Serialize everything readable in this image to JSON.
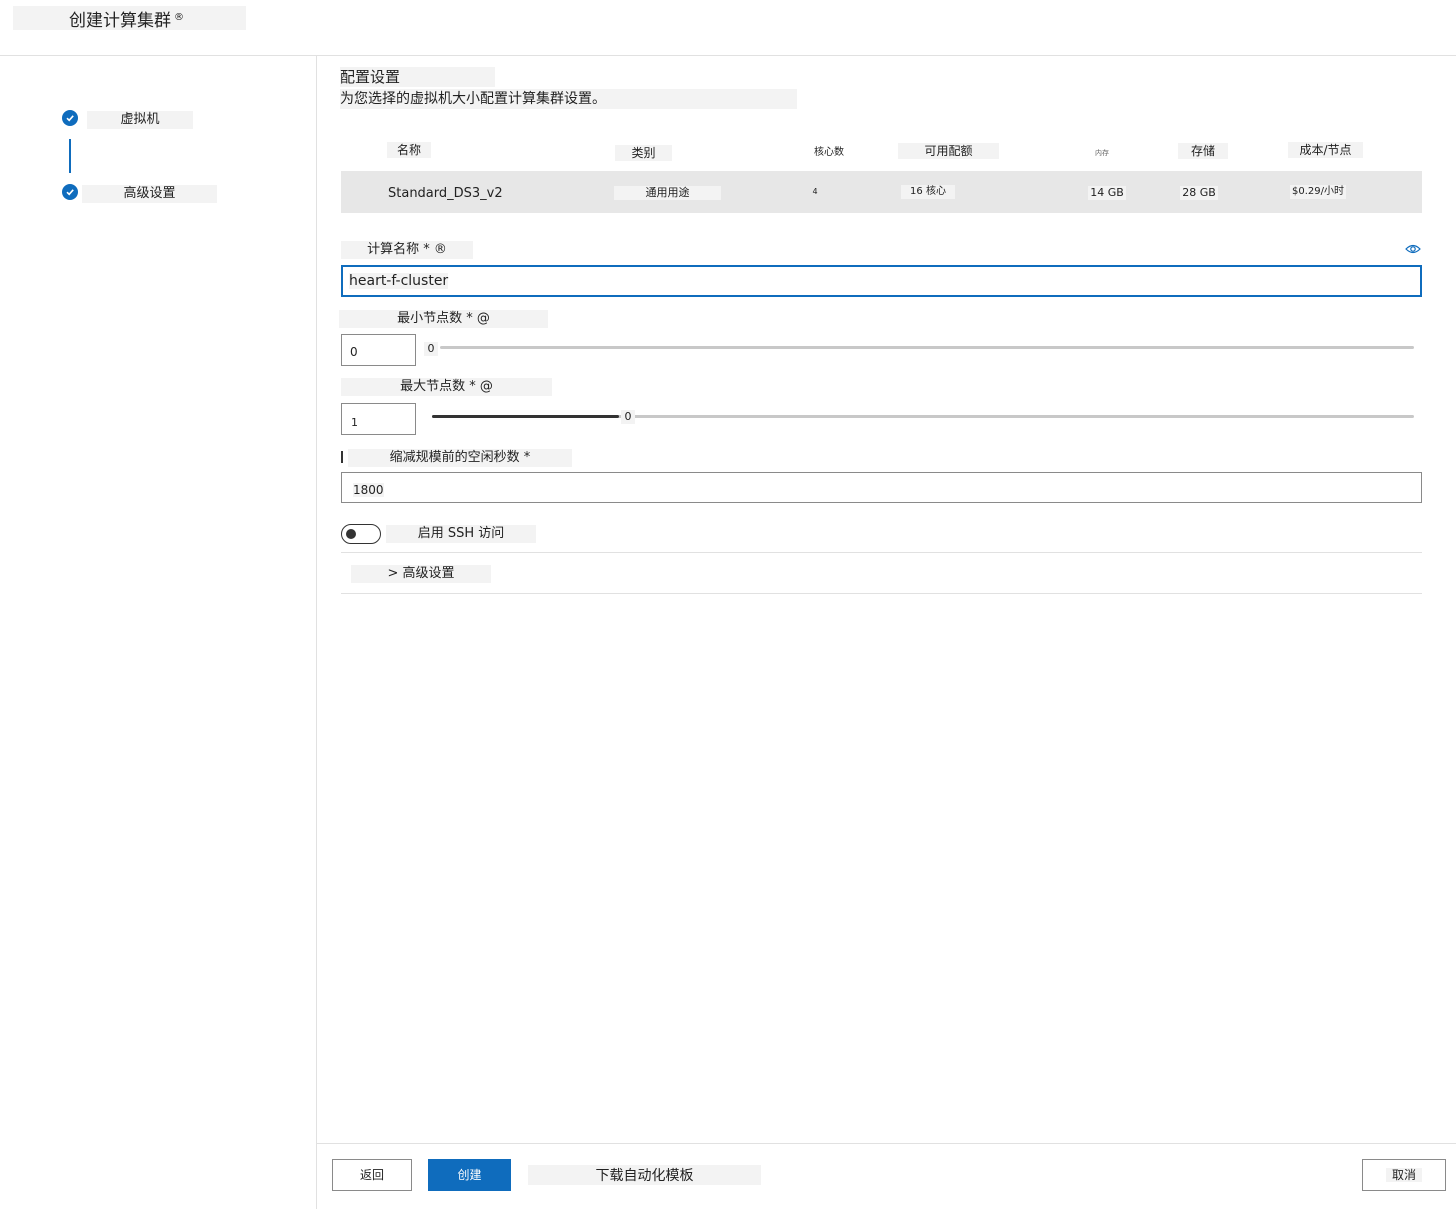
{
  "header": {
    "title": "创建计算集群",
    "title_mark": "®"
  },
  "steps": [
    {
      "label": "虚拟机"
    },
    {
      "label": "高级设置"
    }
  ],
  "main": {
    "section_title": "配置设置",
    "section_subtitle": "为您选择的虚拟机大小配置计算集群设置。",
    "table": {
      "headers": [
        "名称",
        "类别",
        "核心数",
        "可用配额",
        "内存",
        "存储",
        "成本/节点"
      ],
      "row": [
        "Standard_DS3_v2",
        "通用用途",
        "4",
        "16 核心",
        "14 GB",
        "28 GB",
        "$0.29/小时"
      ]
    },
    "compute_name": {
      "label": "计算名称 * ®",
      "value": "heart-f-cluster"
    },
    "min_nodes": {
      "label": "最小节点数 * @",
      "value": "0",
      "slider_label": "0"
    },
    "max_nodes": {
      "label": "最大节点数 * @",
      "value": "1",
      "slider_label": "0",
      "slider_fraction": 0.19
    },
    "idle_seconds": {
      "label": "缩减规模前的空闲秒数 *",
      "value": "1800"
    },
    "ssh": {
      "label": "启用 SSH 访问",
      "enabled": false
    },
    "advanced": {
      "label": "> 高级设置"
    }
  },
  "footer": {
    "back": "返回",
    "create": "创建",
    "download": "下载自动化模板",
    "cancel": "取消"
  },
  "colors": {
    "accent": "#0f6cbd"
  }
}
